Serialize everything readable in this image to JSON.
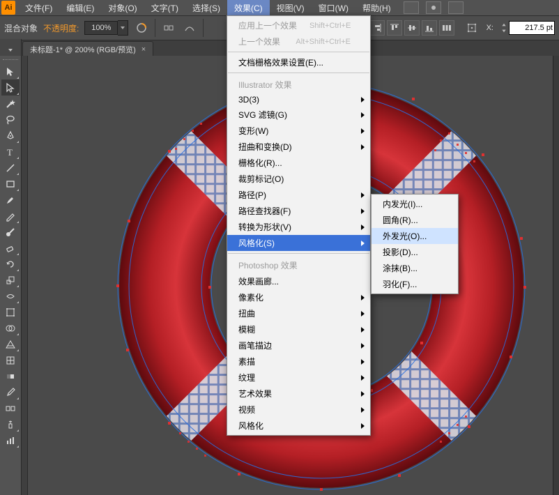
{
  "app_icon": "Ai",
  "menubar": {
    "items": [
      "文件(F)",
      "编辑(E)",
      "对象(O)",
      "文字(T)",
      "选择(S)",
      "效果(C)",
      "视图(V)",
      "窗口(W)",
      "帮助(H)"
    ],
    "open_index": 5
  },
  "controlbar": {
    "mode_label": "混合对象",
    "opacity_label": "不透明度:",
    "opacity_value": "100%",
    "x_label": "X:",
    "x_value": "217.5 pt"
  },
  "document_tab": {
    "title": "未标题-1* @ 200% (RGB/预览)",
    "close_glyph": "×"
  },
  "effects_menu": {
    "apply_last": "应用上一个效果",
    "apply_last_short": "Shift+Ctrl+E",
    "last_effect": "上一个效果",
    "last_effect_short": "Alt+Shift+Ctrl+E",
    "doc_raster": "文档栅格效果设置(E)...",
    "header_illustrator": "Illustrator 效果",
    "ill_items": [
      "3D(3)",
      "SVG 滤镜(G)",
      "变形(W)",
      "扭曲和变换(D)",
      "栅格化(R)...",
      "裁剪标记(O)",
      "路径(P)",
      "路径查找器(F)",
      "转换为形状(V)",
      "风格化(S)"
    ],
    "highlight_index": 9,
    "header_photoshop": "Photoshop 效果",
    "ps_items": [
      "效果画廊...",
      "像素化",
      "扭曲",
      "模糊",
      "画笔描边",
      "素描",
      "纹理",
      "艺术效果",
      "视频",
      "风格化"
    ]
  },
  "stylize_submenu": {
    "items": [
      "内发光(I)...",
      "圆角(R)...",
      "外发光(O)...",
      "投影(D)...",
      "涂抹(B)...",
      "羽化(F)..."
    ],
    "hover_index": 2
  },
  "colors": {
    "accent": "#f49a2b",
    "menu_highlight": "#3a71d8"
  }
}
